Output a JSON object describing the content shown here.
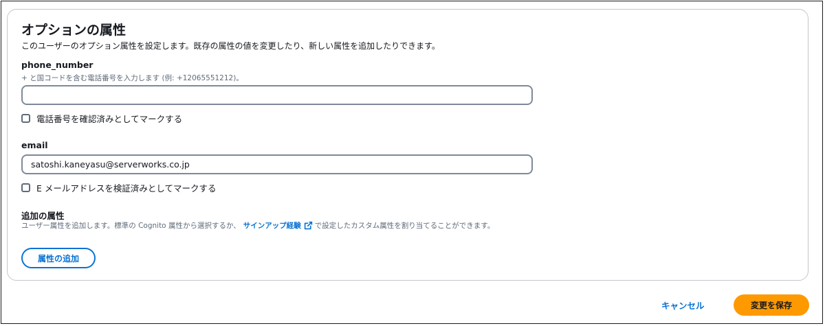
{
  "section": {
    "title": "オプションの属性",
    "description": "このユーザーのオプション属性を設定します。既存の属性の値を変更したり、新しい属性を追加したりできます。"
  },
  "phone": {
    "label": "phone_number",
    "hint": "+ と国コードを含む電話番号を入力します (例: +12065551212)。",
    "value": "",
    "verify_label": "電話番号を確認済みとしてマークする",
    "verified": false
  },
  "email": {
    "label": "email",
    "value": "satoshi.kaneyasu@serverworks.co.jp",
    "verify_label": "E メールアドレスを検証済みとしてマークする",
    "verified": false
  },
  "additional": {
    "title": "追加の属性",
    "desc_before": "ユーザー属性を追加します。標準の Cognito 属性から選択するか、",
    "link_text": "サインアップ経験",
    "link_icon": "external-link-icon",
    "desc_after": "で設定したカスタム属性を割り当てることができます。",
    "add_button": "属性の追加"
  },
  "footer": {
    "cancel": "キャンセル",
    "save": "変更を保存"
  },
  "colors": {
    "link": "#0972d3",
    "primary_button": "#ff9900",
    "input_border": "#7d8998",
    "card_border": "#c6c6cd"
  }
}
